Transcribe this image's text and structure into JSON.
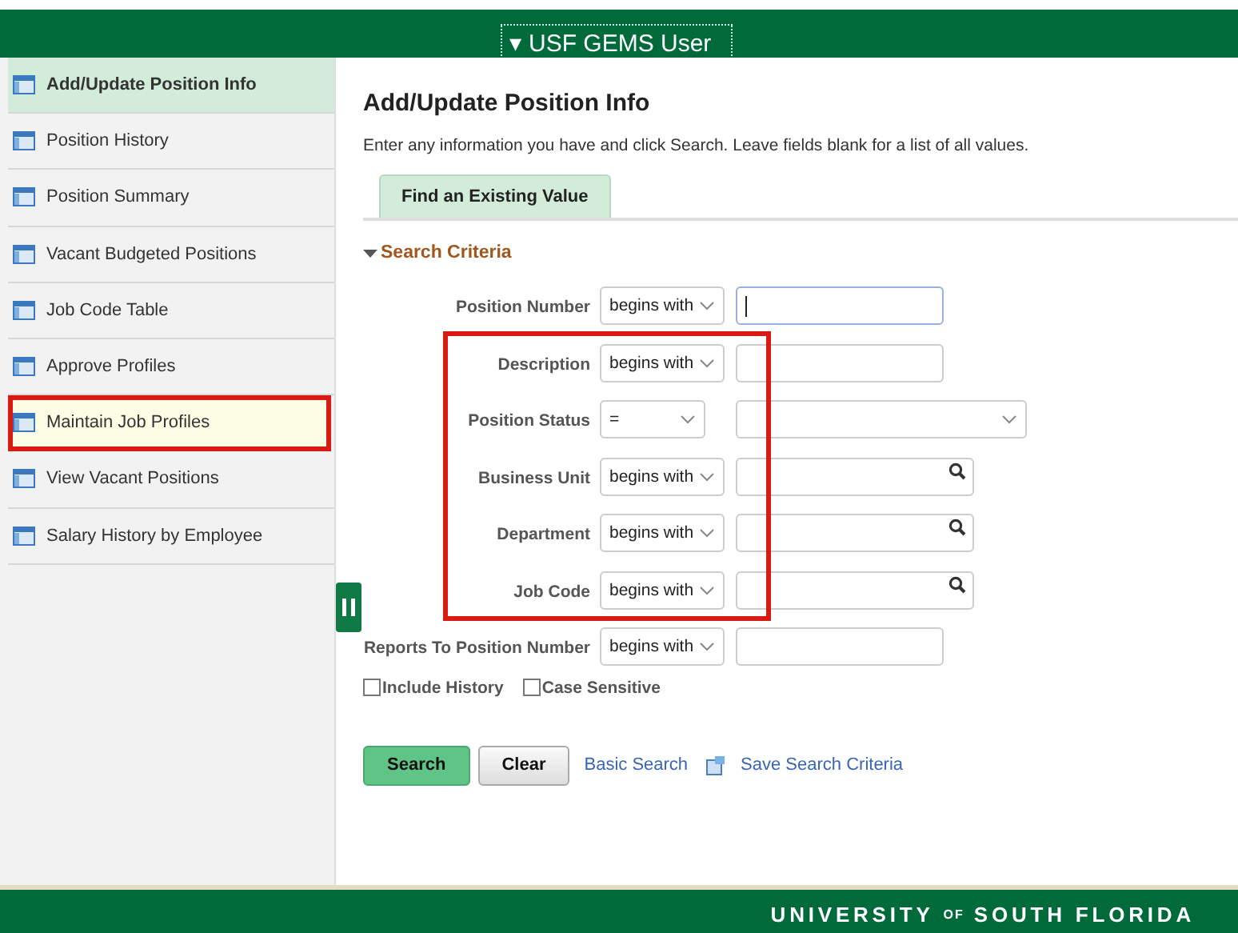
{
  "header": {
    "user_menu": "▾ USF GEMS User"
  },
  "sidebar": {
    "items": [
      {
        "label": "Add/Update Position Info",
        "selected": true,
        "highlighted": false
      },
      {
        "label": "Position History",
        "selected": false,
        "highlighted": false
      },
      {
        "label": "Position Summary",
        "selected": false,
        "highlighted": false
      },
      {
        "label": "Vacant Budgeted Positions",
        "selected": false,
        "highlighted": false
      },
      {
        "label": "Job Code Table",
        "selected": false,
        "highlighted": false
      },
      {
        "label": "Approve Profiles",
        "selected": false,
        "highlighted": false
      },
      {
        "label": "Maintain Job Profiles",
        "selected": false,
        "highlighted": true
      },
      {
        "label": "View Vacant Positions",
        "selected": false,
        "highlighted": false
      },
      {
        "label": "Salary History by Employee",
        "selected": false,
        "highlighted": false
      }
    ]
  },
  "page": {
    "title": "Add/Update Position Info",
    "instructions": "Enter any information you have and click Search. Leave fields blank for a list of all values.",
    "tabs": [
      {
        "label": "Find an Existing Value",
        "selected": true
      }
    ],
    "section": {
      "title": "Search Criteria",
      "expanded": true
    },
    "fields": [
      {
        "label": "Position Number",
        "operator": "begins with",
        "kind": "text",
        "focused": true,
        "highlighted": false
      },
      {
        "label": "Description",
        "operator": "begins with",
        "kind": "text",
        "focused": false,
        "highlighted": true
      },
      {
        "label": "Position Status",
        "operator": "=",
        "kind": "select",
        "highlighted": true
      },
      {
        "label": "Business Unit",
        "operator": "begins with",
        "kind": "lookup",
        "highlighted": true
      },
      {
        "label": "Department",
        "operator": "begins with",
        "kind": "lookup",
        "highlighted": true
      },
      {
        "label": "Job Code",
        "operator": "begins with",
        "kind": "lookup",
        "highlighted": true
      },
      {
        "label": "Reports To Position Number",
        "operator": "begins with",
        "kind": "text",
        "focused": false,
        "highlighted": false
      }
    ],
    "options": [
      {
        "label": "Include History",
        "checked": false
      },
      {
        "label": "Case Sensitive",
        "checked": false
      }
    ],
    "buttons": [
      {
        "label": "Search",
        "kind": "primary"
      },
      {
        "label": "Clear",
        "kind": "secondary"
      }
    ],
    "links": [
      {
        "label": "Basic Search",
        "kind": "plain"
      },
      {
        "label": "Save Search Criteria",
        "kind": "save"
      }
    ]
  },
  "footer": {
    "logo": [
      {
        "text": "UNIVERSITY",
        "kind": "large"
      },
      {
        "text": "OF",
        "kind": "small"
      },
      {
        "text": "SOUTH FLORIDA",
        "kind": "large"
      }
    ]
  }
}
